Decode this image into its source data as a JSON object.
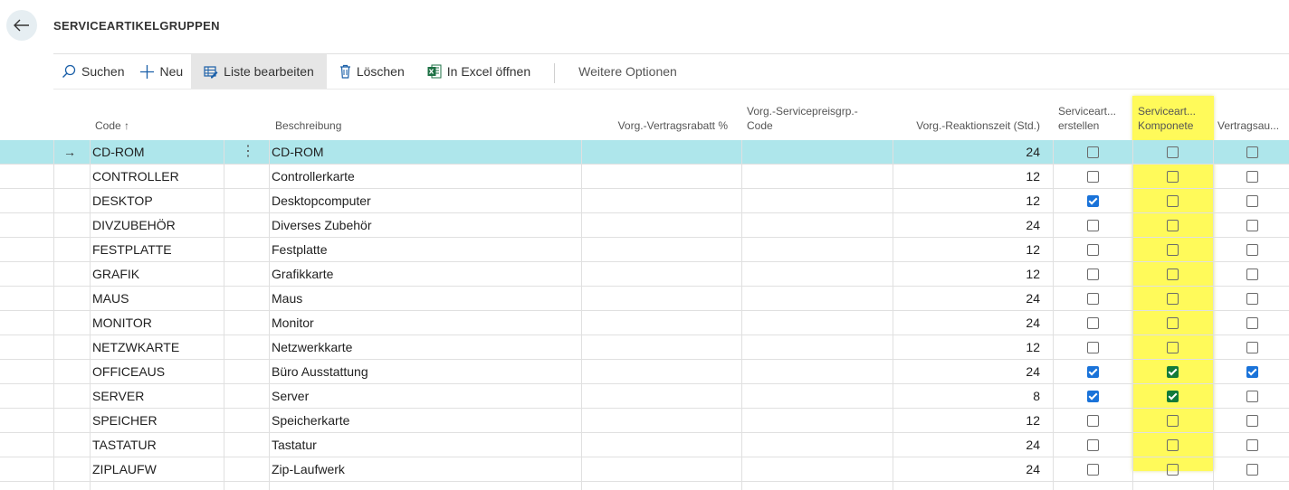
{
  "page": {
    "title": "SERVICEARTIKELGRUPPEN",
    "back_icon": "arrow-left-icon"
  },
  "toolbar": {
    "search": "Suchen",
    "new": "Neu",
    "edit_list": "Liste bearbeiten",
    "delete": "Löschen",
    "open_excel": "In Excel öffnen",
    "more": "Weitere Optionen"
  },
  "columns": {
    "code": "Code ↑",
    "description": "Beschreibung",
    "contract_discount": "Vorg.-Vertragsrabatt %",
    "price_group_l1": "Vorg.-Servicepreisgrp.-",
    "price_group_l2": "Code",
    "response_time": "Vorg.-Reaktionszeit (Std.)",
    "create_l1": "Serviceart...",
    "create_l2": "erstellen",
    "component_l1": "Serviceart...",
    "component_l2": "Komponete",
    "contract": "Vertragsau..."
  },
  "rows": [
    {
      "code": "CD-ROM",
      "description": "CD-ROM",
      "response": "24",
      "create": false,
      "component": false,
      "contract": false,
      "selected": true
    },
    {
      "code": "CONTROLLER",
      "description": "Controllerkarte",
      "response": "12",
      "create": false,
      "component": false,
      "contract": false
    },
    {
      "code": "DESKTOP",
      "description": "Desktopcomputer",
      "response": "12",
      "create": true,
      "component": false,
      "contract": false
    },
    {
      "code": "DIVZUBEHÖR",
      "description": "Diverses Zubehör",
      "response": "24",
      "create": false,
      "component": false,
      "contract": false
    },
    {
      "code": "FESTPLATTE",
      "description": "Festplatte",
      "response": "12",
      "create": false,
      "component": false,
      "contract": false
    },
    {
      "code": "GRAFIK",
      "description": "Grafikkarte",
      "response": "12",
      "create": false,
      "component": false,
      "contract": false
    },
    {
      "code": "MAUS",
      "description": "Maus",
      "response": "24",
      "create": false,
      "component": false,
      "contract": false
    },
    {
      "code": "MONITOR",
      "description": "Monitor",
      "response": "24",
      "create": false,
      "component": false,
      "contract": false
    },
    {
      "code": "NETZWKARTE",
      "description": "Netzwerkkarte",
      "response": "12",
      "create": false,
      "component": false,
      "contract": false
    },
    {
      "code": "OFFICEAUS",
      "description": "Büro Ausstattung",
      "response": "24",
      "create": true,
      "component": true,
      "contract": true
    },
    {
      "code": "SERVER",
      "description": "Server",
      "response": "8",
      "create": true,
      "component": true,
      "contract": false
    },
    {
      "code": "SPEICHER",
      "description": "Speicherkarte",
      "response": "12",
      "create": false,
      "component": false,
      "contract": false
    },
    {
      "code": "TASTATUR",
      "description": "Tastatur",
      "response": "24",
      "create": false,
      "component": false,
      "contract": false
    },
    {
      "code": "ZIPLAUFW",
      "description": "Zip-Laufwerk",
      "response": "24",
      "create": false,
      "component": false,
      "contract": false
    }
  ],
  "colors": {
    "selected_row": "#aee6eb",
    "highlight": "#fffa5a",
    "checkbox_on": "#1a73d9"
  }
}
